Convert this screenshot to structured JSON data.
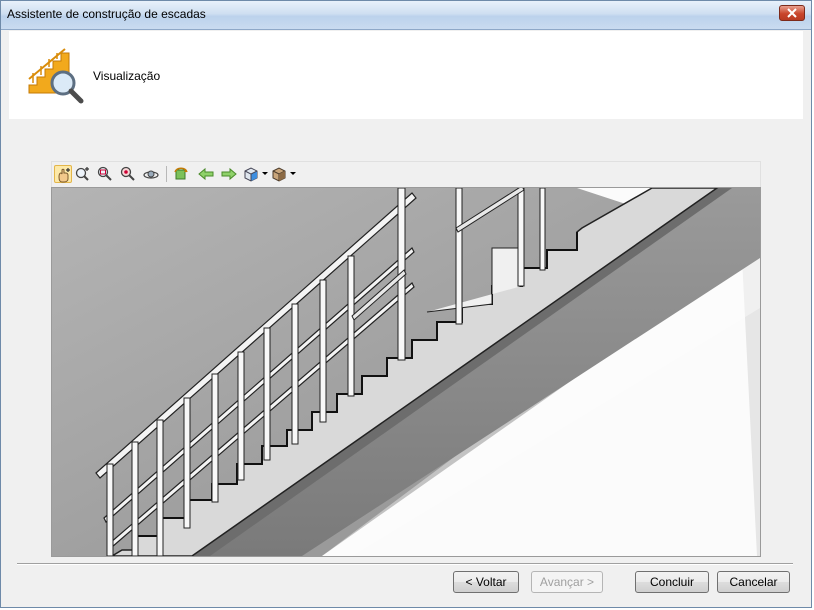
{
  "window": {
    "title": "Assistente de construção de escadas"
  },
  "header": {
    "heading": "Visualização",
    "icon": "staircase-magnifier-icon"
  },
  "toolbar": {
    "tools": [
      {
        "name": "pan-icon",
        "active": true
      },
      {
        "name": "zoom-in-icon"
      },
      {
        "name": "zoom-window-icon"
      },
      {
        "name": "zoom-extents-icon"
      },
      {
        "name": "orbit-icon"
      },
      {
        "name": "rotate-icon"
      },
      {
        "name": "back-arrow-icon"
      },
      {
        "name": "forward-arrow-icon"
      },
      {
        "name": "view-cube-icon"
      },
      {
        "name": "render-mode-icon"
      }
    ]
  },
  "buttons": {
    "back": "< Voltar",
    "next": "Avançar >",
    "finish": "Concluir",
    "cancel": "Cancelar"
  },
  "colors": {
    "titlebar": "#cfdff1",
    "close": "#c9462c",
    "accent_icon": "#f4b400"
  }
}
